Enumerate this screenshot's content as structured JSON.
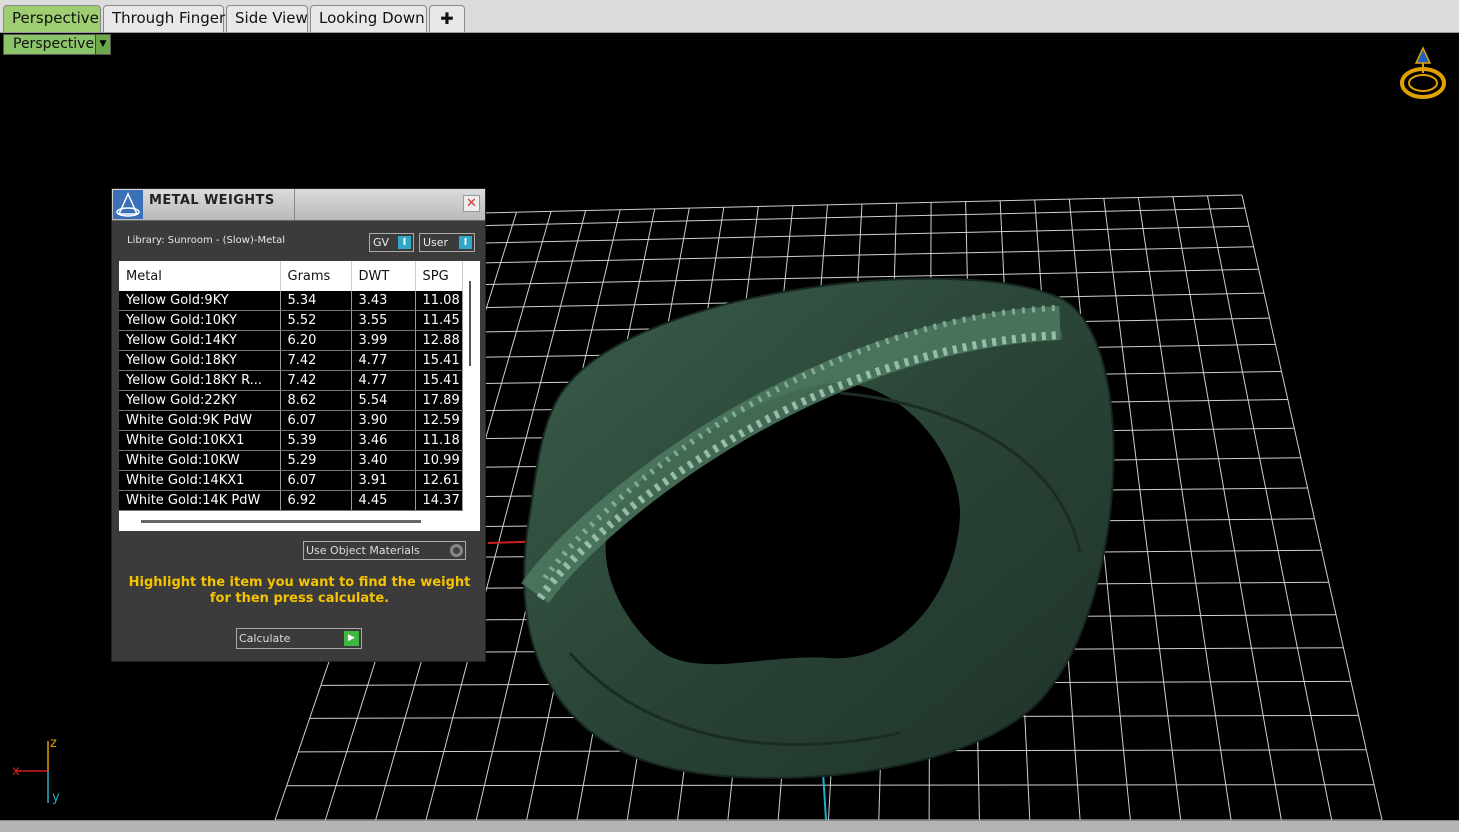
{
  "tabs": [
    {
      "label": "Perspective",
      "active": true
    },
    {
      "label": "Through Finger",
      "active": false
    },
    {
      "label": "Side View",
      "active": false
    },
    {
      "label": "Looking Down",
      "active": false
    }
  ],
  "add_tab_icon": "plus-icon",
  "viewport": {
    "selector_label": "Perspective",
    "dropdown_icon": "dropdown-arrow-icon"
  },
  "axes": {
    "x": "x",
    "y": "y",
    "z": "z"
  },
  "panel": {
    "title": "METAL WEIGHTS",
    "close_icon": "close-icon",
    "library_label": "Library: Sunroom - (Slow)-Metal",
    "toggle_gv": "GV",
    "toggle_user": "User",
    "toggle_indicator": "I",
    "columns": [
      "Metal",
      "Grams",
      "DWT",
      "SPG"
    ],
    "rows": [
      [
        "Yellow Gold:9KY",
        "5.34",
        "3.43",
        "11.08"
      ],
      [
        "Yellow Gold:10KY",
        "5.52",
        "3.55",
        "11.45"
      ],
      [
        "Yellow Gold:14KY",
        "6.20",
        "3.99",
        "12.88"
      ],
      [
        "Yellow Gold:18KY",
        "7.42",
        "4.77",
        "15.41"
      ],
      [
        "Yellow Gold:18KY R...",
        "7.42",
        "4.77",
        "15.41"
      ],
      [
        "Yellow Gold:22KY",
        "8.62",
        "5.54",
        "17.89"
      ],
      [
        "White Gold:9K PdW",
        "6.07",
        "3.90",
        "12.59"
      ],
      [
        "White Gold:10KX1",
        "5.39",
        "3.46",
        "11.18"
      ],
      [
        "White Gold:10KW",
        "5.29",
        "3.40",
        "10.99"
      ],
      [
        "White Gold:14KX1",
        "6.07",
        "3.91",
        "12.61"
      ],
      [
        "White Gold:14K PdW",
        "6.92",
        "4.45",
        "14.37"
      ]
    ],
    "use_object_materials": "Use Object Materials",
    "hint_line1": "Highlight the item you want to find the weight",
    "hint_line2": "for then press calculate.",
    "calculate_label": "Calculate"
  },
  "colors": {
    "active_tab": "#9fce72",
    "ring": "#2c4a3c",
    "hint": "#f5c400",
    "grid": "#d0d0d0"
  }
}
